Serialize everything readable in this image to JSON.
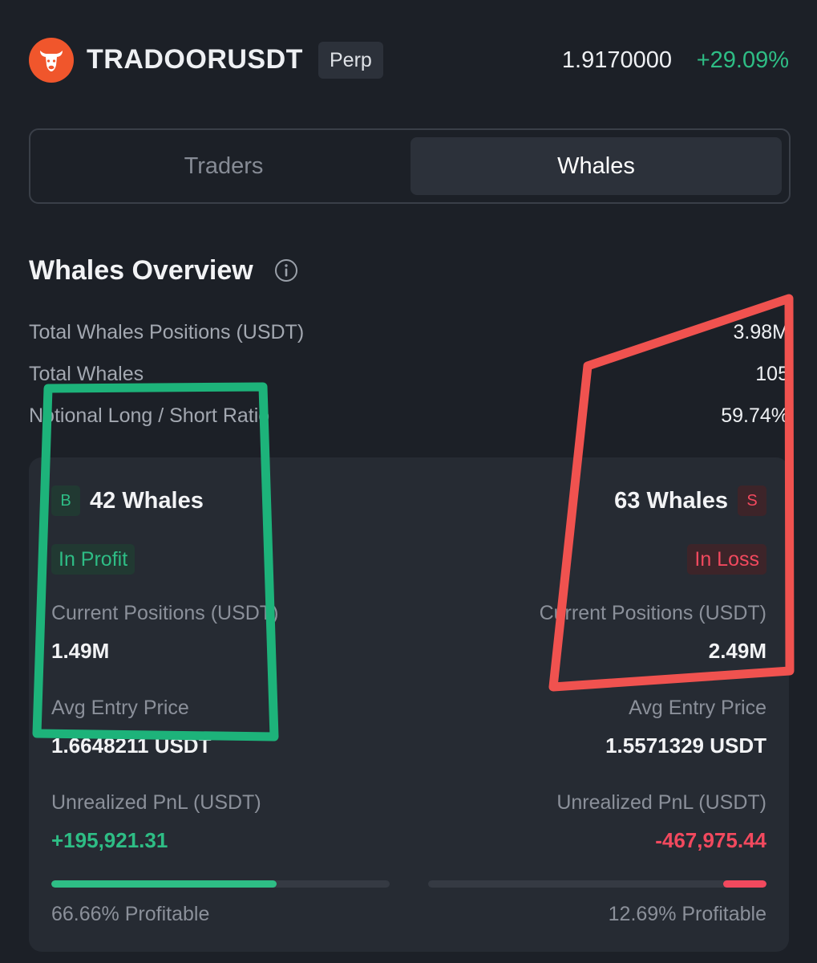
{
  "header": {
    "symbol": "TRADOORUSDT",
    "contract_type": "Perp",
    "price": "1.9170000",
    "change": "+29.09%",
    "logo_icon": "bull-head-icon",
    "logo_color": "#f0562c"
  },
  "tabs": [
    {
      "label": "Traders",
      "active": false
    },
    {
      "label": "Whales",
      "active": true
    }
  ],
  "overview": {
    "title": "Whales Overview",
    "info_icon": "info-icon",
    "stats": [
      {
        "label": "Total Whales Positions (USDT)",
        "value": "3.98M"
      },
      {
        "label": "Total Whales",
        "value": "105"
      },
      {
        "label": "Notional Long / Short Ratio",
        "value": "59.74%"
      }
    ]
  },
  "long_side": {
    "badge": "B",
    "whales": "42 Whales",
    "status": "In Profit",
    "current_positions_label": "Current Positions (USDT)",
    "current_positions": "1.49M",
    "avg_entry_label": "Avg Entry Price",
    "avg_entry": "1.6648211 USDT",
    "pnl_label": "Unrealized PnL (USDT)",
    "pnl": "+195,921.31",
    "profitable_pct": 66.66,
    "profitable_text": "66.66% Profitable"
  },
  "short_side": {
    "badge": "S",
    "whales": "63 Whales",
    "status": "In Loss",
    "current_positions_label": "Current Positions (USDT)",
    "current_positions": "2.49M",
    "avg_entry_label": "Avg Entry Price",
    "avg_entry": "1.5571329 USDT",
    "pnl_label": "Unrealized PnL (USDT)",
    "pnl": "-467,975.44",
    "profitable_pct": 12.69,
    "profitable_text": "12.69% Profitable"
  },
  "colors": {
    "green": "#2ebd85",
    "red": "#f2495e",
    "annotation_green": "#1db37a",
    "annotation_red": "#f0524f"
  }
}
